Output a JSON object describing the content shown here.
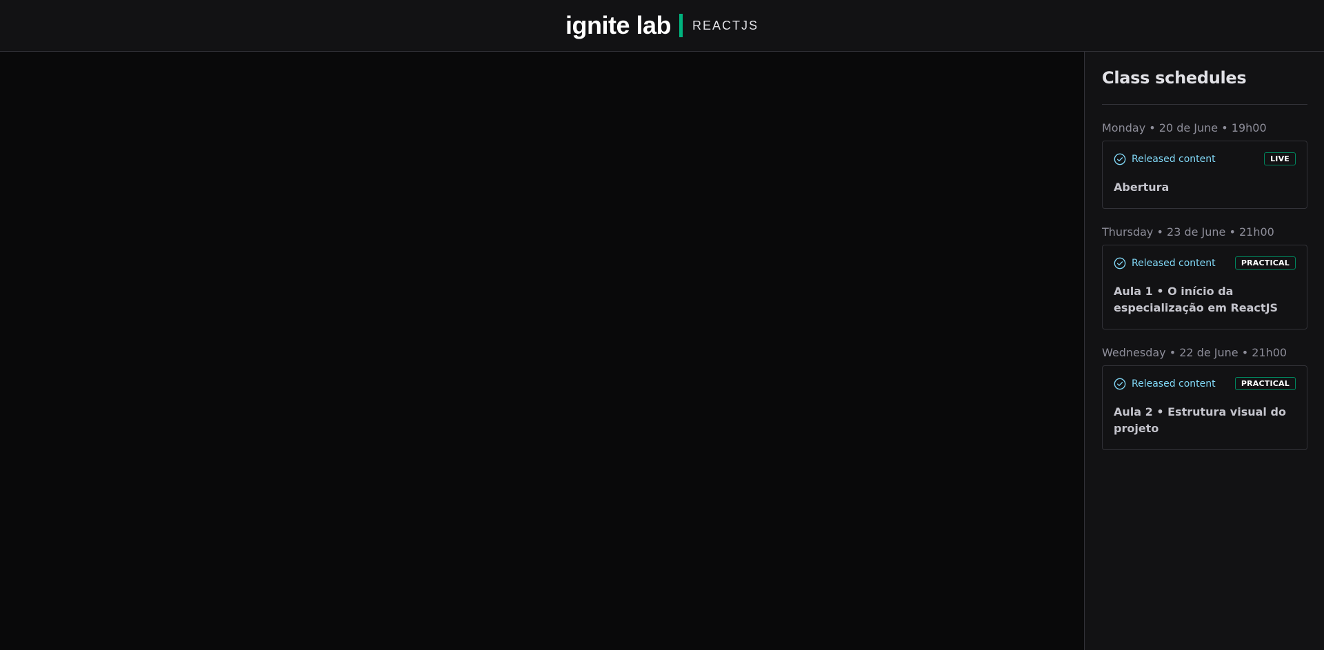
{
  "header": {
    "logo_text": "ignite lab",
    "logo_sub": "REACTJS"
  },
  "sidebar": {
    "title": "Class schedules",
    "lessons": [
      {
        "date": "Monday • 20 de June • 19h00",
        "status": "Released content",
        "badge": "LIVE",
        "title": "Abertura"
      },
      {
        "date": "Thursday • 23 de June • 21h00",
        "status": "Released content",
        "badge": "PRACTICAL",
        "title": "Aula 1 • O início da especialização em ReactJS"
      },
      {
        "date": "Wednesday • 22 de June • 21h00",
        "status": "Released content",
        "badge": "PRACTICAL",
        "title": "Aula 2 • Estrutura visual do projeto"
      }
    ]
  },
  "colors": {
    "accent": "#00b37e",
    "status_blue": "#81d8f7",
    "badge_border": "#00875f",
    "background": "#09090a",
    "panel": "#121214"
  },
  "icons": {
    "status_icon": "check-circle-icon"
  }
}
